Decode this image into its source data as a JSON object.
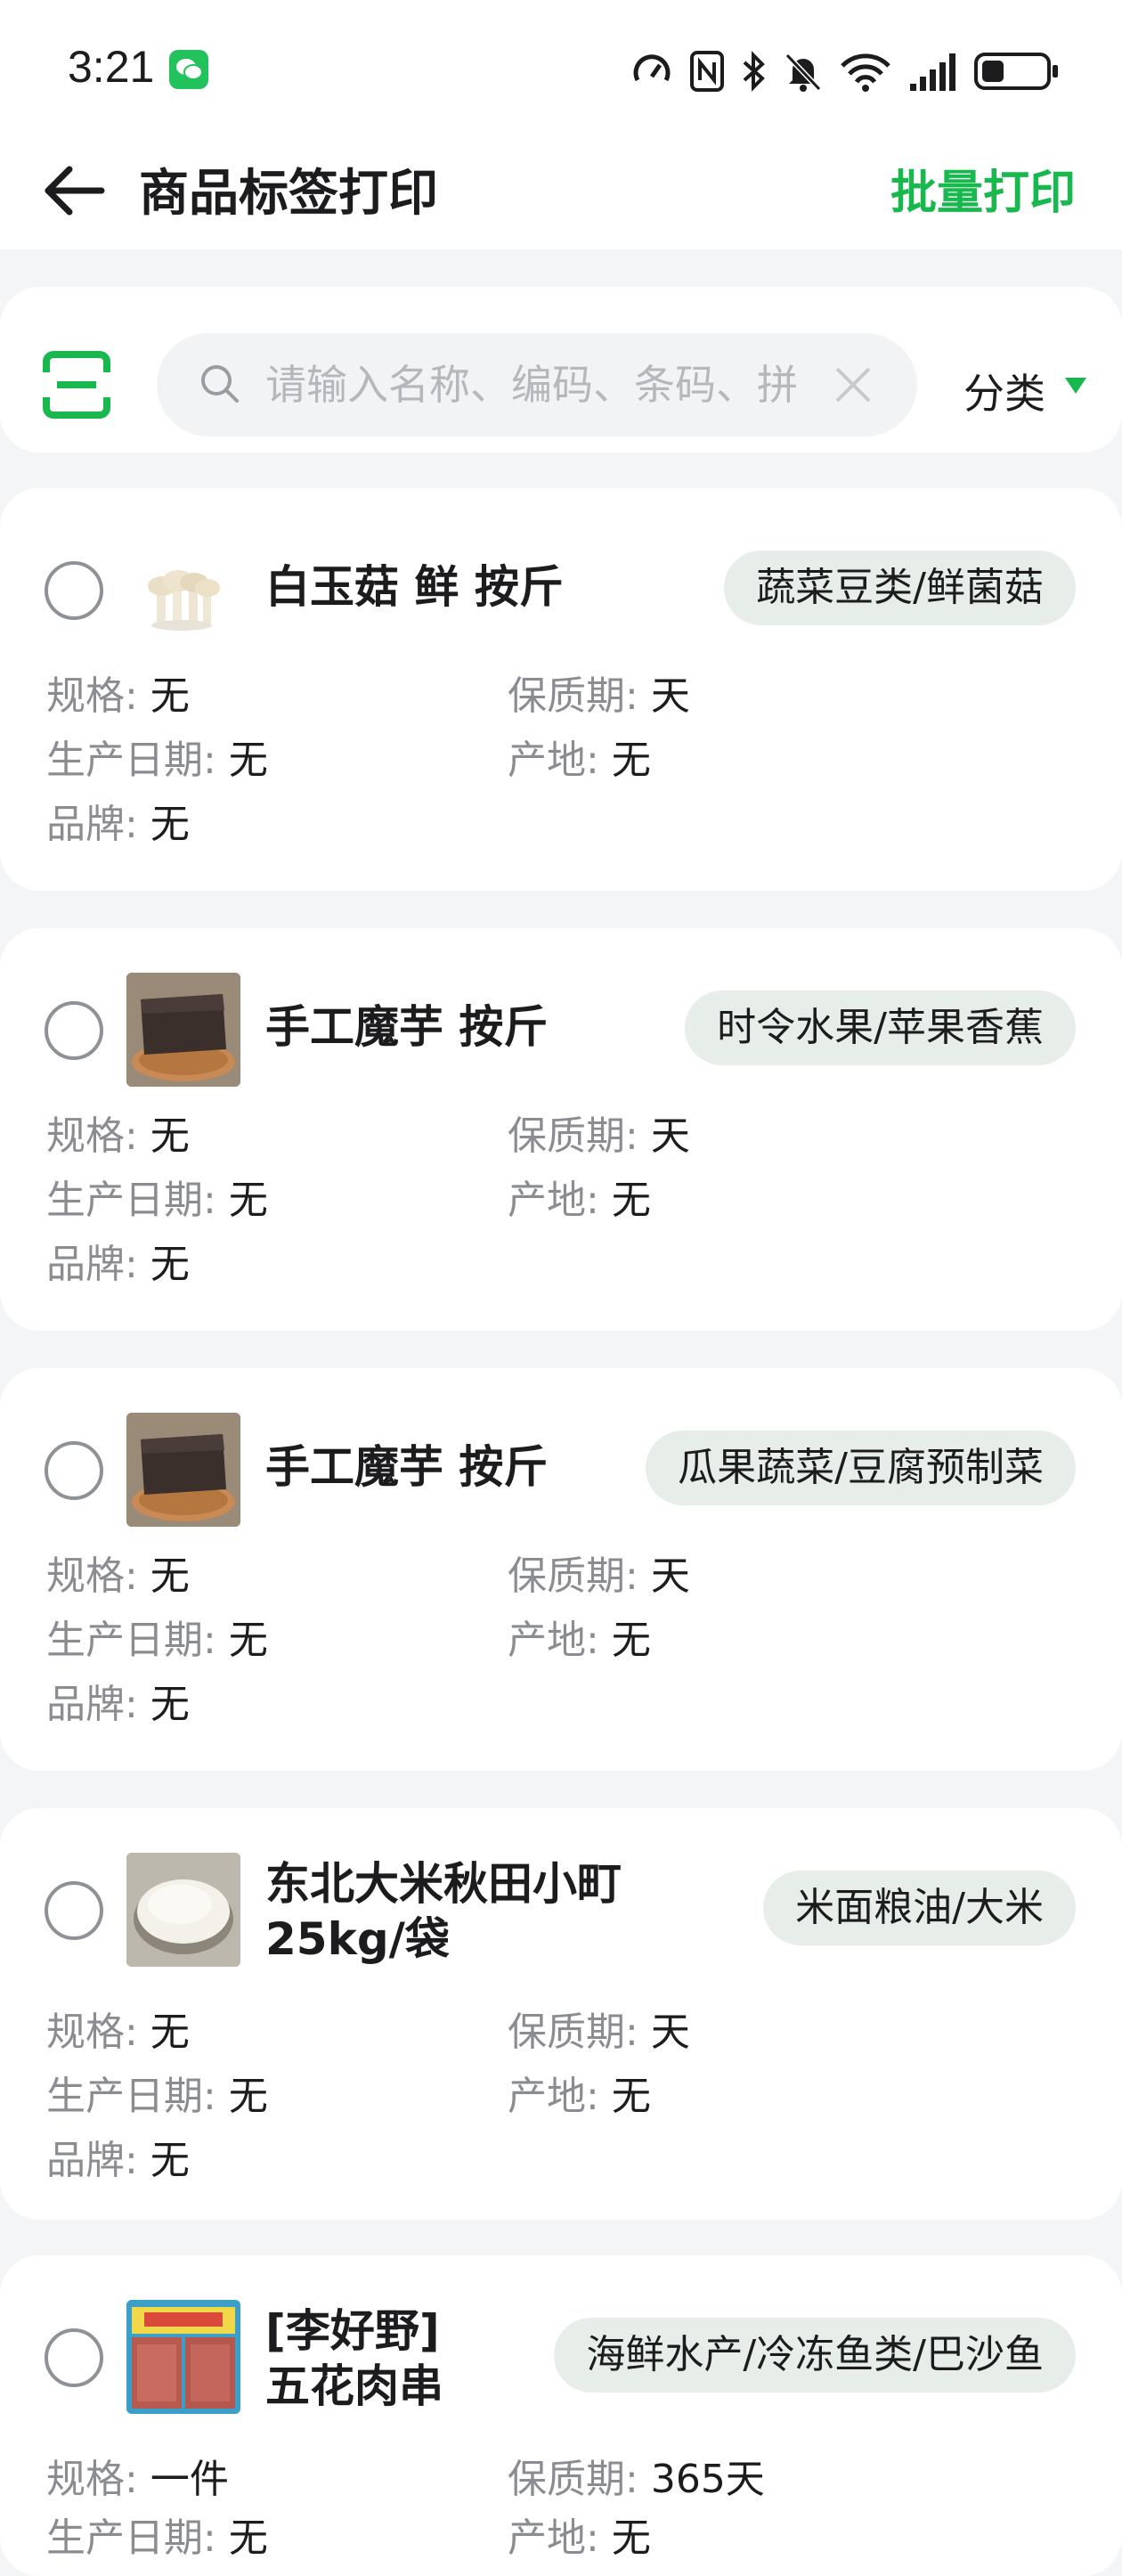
{
  "status_bar": {
    "time": "3:21",
    "battery_level": 0.35,
    "icons": [
      "wechat-icon",
      "nfc-speed-icon",
      "nfc-icon",
      "bluetooth-icon",
      "mute-icon",
      "wifi-icon",
      "signal-icon",
      "battery-icon"
    ]
  },
  "header": {
    "title": "商品标签打印",
    "batch_print": "批量打印"
  },
  "search": {
    "placeholder": "请输入名称、编码、条码、拼",
    "value": "",
    "category_label": "分类"
  },
  "colors": {
    "accent": "#19b84f",
    "tag_bg": "#e7eeea",
    "label_gray": "#8a8c91"
  },
  "field_labels": {
    "spec": "规格:",
    "shelf_life": "保质期:",
    "production_date": "生产日期:",
    "origin": "产地:",
    "brand": "品牌:"
  },
  "products": [
    {
      "name": "白玉菇 鲜 按斤",
      "category": "蔬菜豆类/鲜菌菇",
      "spec": "无",
      "shelf_life": "天",
      "production_date": "无",
      "origin": "无",
      "brand": "无",
      "thumb": "mushroom-image"
    },
    {
      "name": "手工魔芋 按斤",
      "category": "时令水果/苹果香蕉",
      "spec": "无",
      "shelf_life": "天",
      "production_date": "无",
      "origin": "无",
      "brand": "无",
      "thumb": "konjac-image"
    },
    {
      "name": "手工魔芋 按斤",
      "category": "瓜果蔬菜/豆腐预制菜",
      "spec": "无",
      "shelf_life": "天",
      "production_date": "无",
      "origin": "无",
      "brand": "无",
      "thumb": "konjac-image"
    },
    {
      "name_line1": "东北大米秋田小町",
      "name_line2": "25kg/袋",
      "category": "米面粮油/大米",
      "spec": "无",
      "shelf_life": "天",
      "production_date": "无",
      "origin": "无",
      "brand": "无",
      "thumb": "rice-image"
    },
    {
      "name_line1": "[李好野]",
      "name_line2": "五花肉串",
      "category": "海鲜水产/冷冻鱼类/巴沙鱼",
      "spec": "一件",
      "shelf_life": "365天",
      "production_date": "无",
      "origin": "无",
      "thumb": "pork-skewer-image"
    }
  ]
}
